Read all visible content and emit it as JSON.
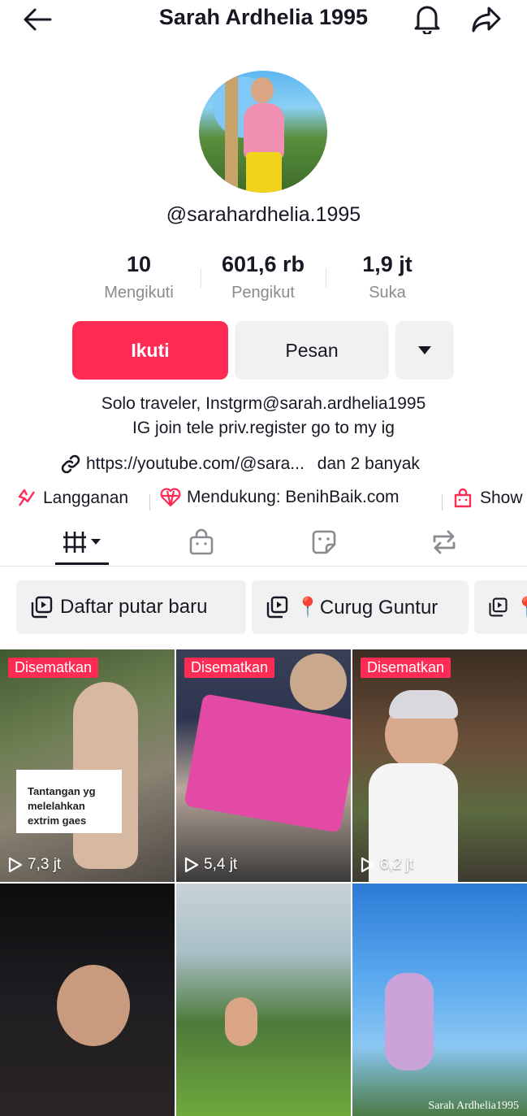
{
  "header": {
    "title": "Sarah Ardhelia 1995",
    "back_icon": "arrow-left-icon",
    "bell_icon": "bell-icon",
    "share_icon": "share-icon"
  },
  "profile": {
    "username": "@sarahardhelia.1995"
  },
  "stats": [
    {
      "value": "10",
      "label": "Mengikuti"
    },
    {
      "value": "601,6 rb",
      "label": "Pengikut"
    },
    {
      "value": "1,9 jt",
      "label": "Suka"
    }
  ],
  "actions": {
    "follow": "Ikuti",
    "message": "Pesan"
  },
  "bio": {
    "line1": "Solo traveler, Instgrm@sarah.ardhelia1995",
    "line2": "IG join tele priv.register go to my ig"
  },
  "link": {
    "url": "https://youtube.com/@sara...",
    "more": "dan 2 banyak"
  },
  "chips": [
    {
      "label": "Langganan",
      "icon": "subscription-icon"
    },
    {
      "label": "Mendukung: BenihBaik.com",
      "icon": "heart-gem-icon"
    },
    {
      "label": "Show",
      "icon": "shop-bag-icon"
    }
  ],
  "playlists": [
    {
      "label": "Daftar putar baru"
    },
    {
      "label": "📍Curug Guntur"
    },
    {
      "label": "📍"
    }
  ],
  "videos": [
    {
      "pinned": "Disematkan",
      "views": "7,3 jt",
      "caption": "Tantangan yg melelahkan extrim gaes"
    },
    {
      "pinned": "Disematkan",
      "views": "5,4 jt"
    },
    {
      "pinned": "Disematkan",
      "views": "6,2 jt"
    },
    {},
    {},
    {
      "watermark": "Sarah Ardhelia1995"
    }
  ],
  "colors": {
    "accent": "#fe2c55",
    "button_gray": "#f1f1f2",
    "muted_text": "#8a8b91"
  }
}
